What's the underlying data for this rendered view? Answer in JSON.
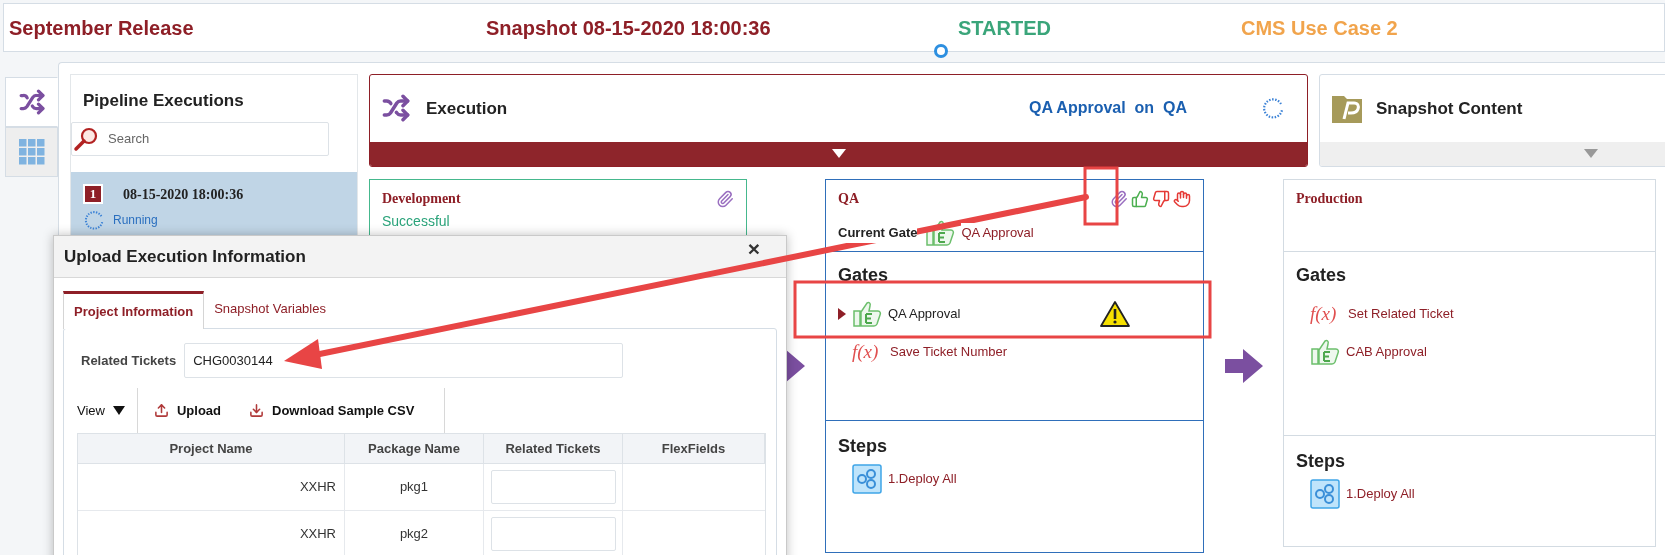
{
  "header": {
    "release": "September Release",
    "snapshot": "Snapshot 08-15-2020 18:00:36",
    "status": "STARTED",
    "use_case": "CMS Use Case 2"
  },
  "side_tabs": [
    {
      "kind": "pipeline",
      "selected": true
    },
    {
      "kind": "grid",
      "selected": false
    }
  ],
  "pipeline_executions": {
    "title": "Pipeline Executions",
    "search": {
      "placeholder": "Search"
    },
    "items": [
      {
        "number": "1",
        "date": "08-15-2020 18:00:36",
        "status": "Running",
        "selected": true
      }
    ]
  },
  "execution": {
    "title": "Execution",
    "gate": "QA Approval",
    "on": "on",
    "environment": "QA"
  },
  "snapshot_content": {
    "title": "Snapshot Content"
  },
  "stages": [
    {
      "kind": "done",
      "name": "Development",
      "status": "Successful",
      "attachments": true,
      "approval_actions": false
    },
    {
      "kind": "active",
      "name": "QA",
      "attachments": true,
      "approval_actions": true,
      "current_gate_label": "Current Gate",
      "current_gate": "QA Approval",
      "gates_title": "Gates",
      "gates": [
        {
          "kind": "approval",
          "name": "QA Approval",
          "selected": true,
          "warning": true
        },
        {
          "kind": "function",
          "icon_text": "f(x)",
          "name": "Save Ticket Number",
          "selected": false,
          "warning": false
        }
      ],
      "steps_title": "Steps",
      "steps": [
        "1.Deploy All"
      ]
    },
    {
      "kind": "pending",
      "name": "Production",
      "attachments": false,
      "approval_actions": false,
      "gates_title": "Gates",
      "gates": [
        {
          "kind": "function",
          "icon_text": "f(x)",
          "name": "Set Related Ticket",
          "selected": false,
          "warning": false
        },
        {
          "kind": "approval",
          "name": "CAB Approval",
          "selected": false,
          "warning": false
        }
      ],
      "steps_title": "Steps",
      "steps": [
        "1.Deploy All"
      ]
    }
  ],
  "dialog": {
    "title": "Upload Execution Information",
    "close": "×",
    "tabs": [
      {
        "label": "Project Information",
        "selected": true
      },
      {
        "label": "Snapshot Variables",
        "selected": false
      }
    ],
    "related_tickets": {
      "label": "Related Tickets",
      "value": "CHG0030144"
    },
    "toolbar": [
      {
        "kind": "view",
        "label": "View"
      },
      {
        "kind": "upload",
        "label": "Upload"
      },
      {
        "kind": "download",
        "label": "Download Sample CSV"
      }
    ],
    "table": {
      "columns": [
        "Project Name",
        "Package Name",
        "Related Tickets",
        "FlexFields"
      ],
      "rows": [
        {
          "project": "XXHR",
          "package": "pkg1"
        },
        {
          "project": "XXHR",
          "package": "pkg2"
        }
      ]
    }
  }
}
